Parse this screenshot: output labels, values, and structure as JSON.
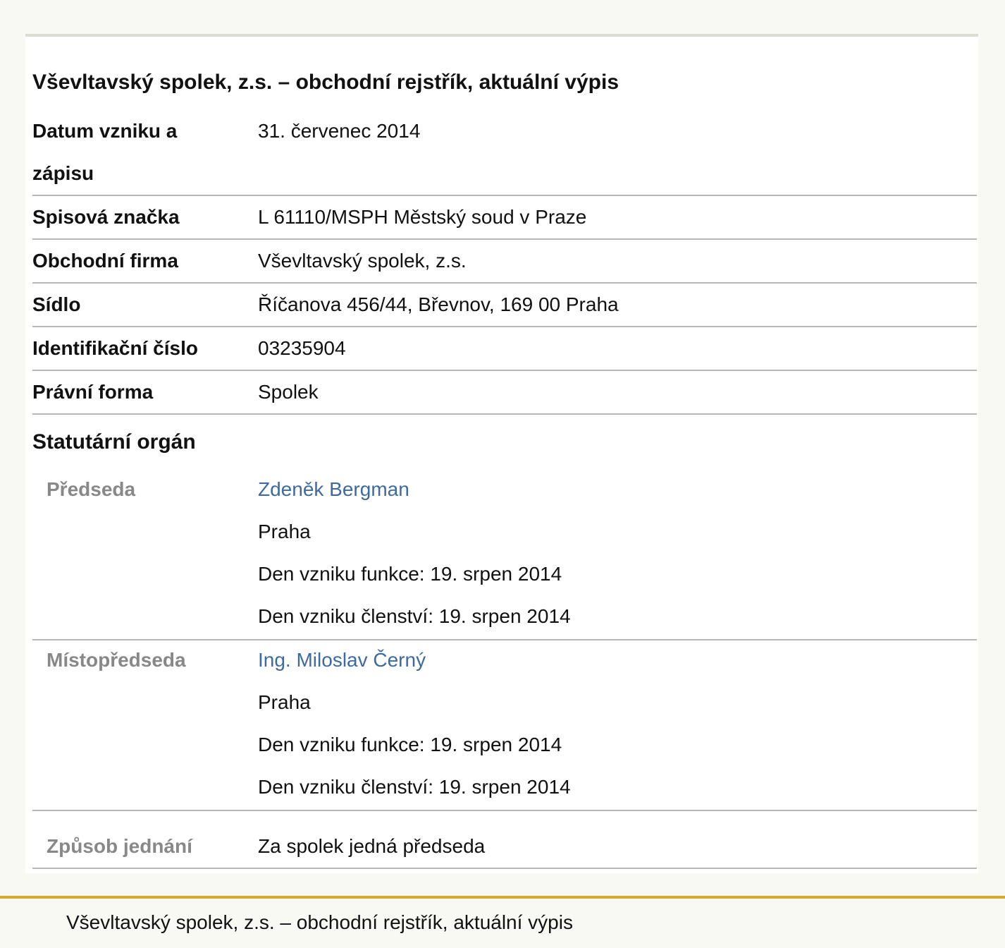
{
  "title": "Vševltavský spolek, z.s. – obchodní rejstřík, aktuální výpis",
  "rows": [
    {
      "label": "Datum vzniku a",
      "label2": "zápisu",
      "value": "31. červenec 2014"
    },
    {
      "label": "Spisová značka",
      "value": "L 61110/MSPH Městský soud v Praze"
    },
    {
      "label": "Obchodní firma",
      "value": "Vševltavský spolek, z.s."
    },
    {
      "label": "Sídlo",
      "value": "Říčanova 456/44, Břevnov, 169 00 Praha"
    },
    {
      "label": "Identifikační číslo",
      "value": "03235904"
    },
    {
      "label": "Právní forma",
      "value": "Spolek"
    }
  ],
  "statutory": {
    "heading": "Statutární orgán",
    "members": [
      {
        "role": "Předseda",
        "name": "Zdeněk Bergman",
        "city": "Praha",
        "function_start": "Den vzniku funkce: 19. srpen 2014",
        "membership_start": "Den vzniku členství: 19. srpen 2014"
      },
      {
        "role": "Místopředseda",
        "name": "Ing. Miloslav Černý",
        "city": "Praha",
        "function_start": "Den vzniku funkce: 19. srpen 2014",
        "membership_start": "Den vzniku členství: 19. srpen 2014"
      }
    ],
    "conduct": {
      "label": "Způsob jednání",
      "value": "Za spolek jedná předseda"
    }
  },
  "footer": {
    "text": "Vševltavský spolek, z.s. – obchodní rejstřík, aktuální výpis"
  },
  "colors": {
    "link": "#3d6aa0",
    "footer_border": "#d8a632",
    "sub_label": "#888888"
  }
}
